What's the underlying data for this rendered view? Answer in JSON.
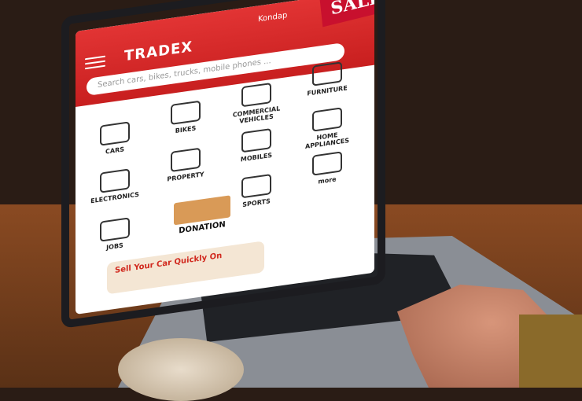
{
  "app": {
    "name": "TRADEX",
    "location": "Kondap",
    "search_placeholder": "Search cars, bikes, trucks, mobile phones ...",
    "sale_label": "SALE"
  },
  "categories": [
    {
      "label": "CARS",
      "icon": "car-icon"
    },
    {
      "label": "BIKES",
      "icon": "bike-icon"
    },
    {
      "label": "COMMERCIAL VEHICLES",
      "icon": "truck-icon"
    },
    {
      "label": "FURNITURE",
      "icon": "furniture-icon"
    },
    {
      "label": "ELECTRONICS",
      "icon": "tv-icon"
    },
    {
      "label": "PROPERTY",
      "icon": "property-icon"
    },
    {
      "label": "MOBILES",
      "icon": "mobile-icon"
    },
    {
      "label": "HOME APPLIANCES",
      "icon": "appliance-icon"
    },
    {
      "label": "JOBS",
      "icon": "jobs-icon"
    },
    {
      "label": "SPORTS",
      "icon": "sports-icon"
    },
    {
      "label": "more",
      "icon": "more-icon"
    }
  ],
  "donation": {
    "label": "DONATION"
  },
  "banner": {
    "label": "Sell Your Car Quickly On"
  }
}
